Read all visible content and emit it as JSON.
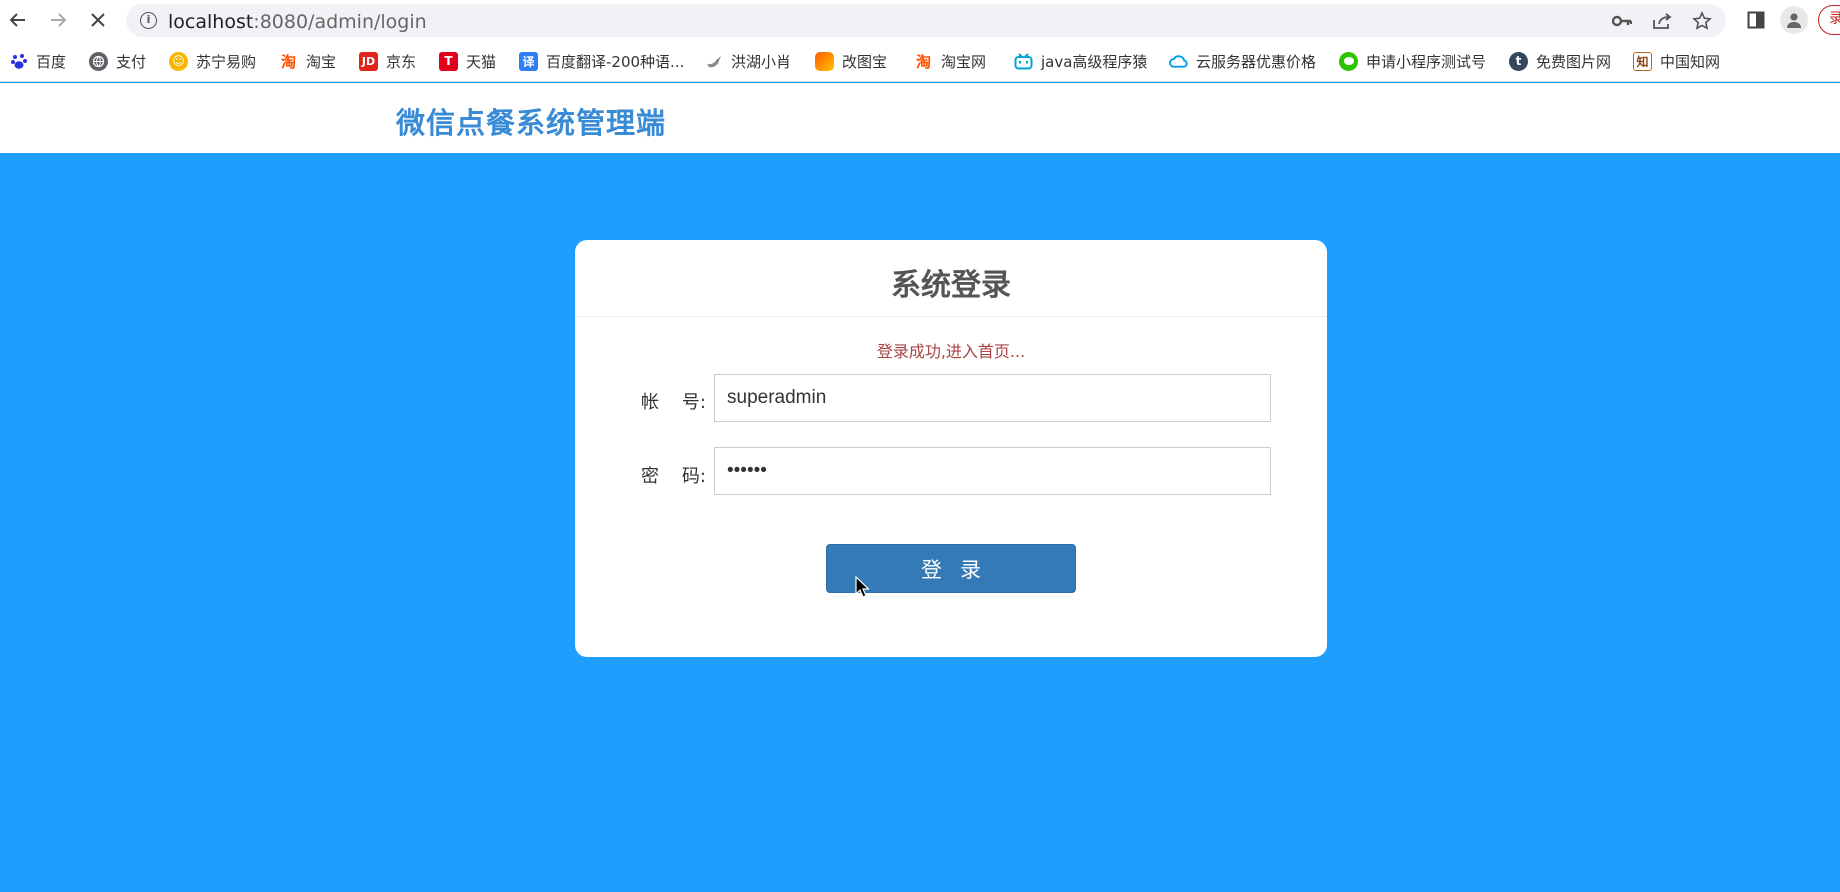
{
  "browser": {
    "url_host": "localhost",
    "url_path": ":8080/admin/login",
    "extension_badge": "录"
  },
  "bookmarks": [
    {
      "label": "百度",
      "icon": "baidu-icon",
      "color": "#2932e1"
    },
    {
      "label": "支付",
      "icon": "globe-icon",
      "color": "#5f6368"
    },
    {
      "label": "苏宁易购",
      "icon": "suning-icon",
      "color": "#f7b500"
    },
    {
      "label": "淘宝",
      "icon": "taobao-icon",
      "color": "#ff5000"
    },
    {
      "label": "京东",
      "icon": "jd-icon",
      "color": "#e1251b"
    },
    {
      "label": "天猫",
      "icon": "tmall-icon",
      "color": "#ff0036"
    },
    {
      "label": "百度翻译-200种语...",
      "icon": "translate-icon",
      "color": "#2e7ef5"
    },
    {
      "label": "洪湖小肖",
      "icon": "bird-icon",
      "color": "#8a8a8a"
    },
    {
      "label": "改图宝",
      "icon": "gaitubao-icon",
      "color": "#ff8a00"
    },
    {
      "label": "淘宝网",
      "icon": "taobao-icon",
      "color": "#ff5000"
    },
    {
      "label": "java高级程序猿",
      "icon": "bilibili-icon",
      "color": "#00a1d6"
    },
    {
      "label": "云服务器优惠价格",
      "icon": "cloud-icon",
      "color": "#00a1e9"
    },
    {
      "label": "申请小程序测试号",
      "icon": "wechat-icon",
      "color": "#2dc100"
    },
    {
      "label": "免费图片网",
      "icon": "tumblr-icon",
      "color": "#36465d"
    },
    {
      "label": "中国知网",
      "icon": "cnki-icon",
      "color": "#b46a1c"
    }
  ],
  "site": {
    "title": "微信点餐系统管理端"
  },
  "login": {
    "title": "系统登录",
    "status_message": "登录成功,进入首页...",
    "account_label": "帐    号:",
    "account_value": "superadmin",
    "password_label": "密    码:",
    "password_value": "••••••",
    "submit_label": "登录"
  },
  "colors": {
    "background": "#1f9ffd",
    "title": "#3a8bd6",
    "button": "#337ab7",
    "status": "#a94442"
  }
}
